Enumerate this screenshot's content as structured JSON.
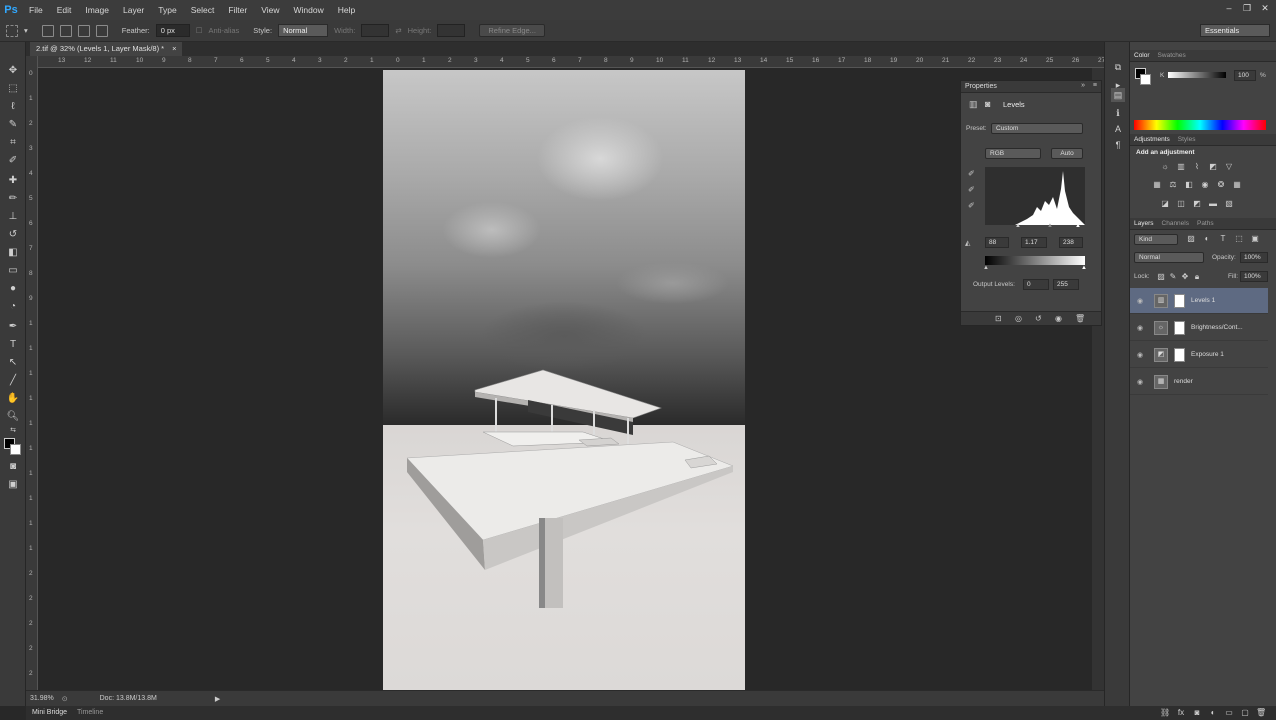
{
  "app": {
    "logo": "Ps"
  },
  "menu": [
    "File",
    "Edit",
    "Image",
    "Layer",
    "Type",
    "Select",
    "Filter",
    "View",
    "Window",
    "Help"
  ],
  "window_controls": [
    "–",
    "❐",
    "✕"
  ],
  "options": {
    "feather_label": "Feather:",
    "feather_value": "0 px",
    "antialias_label": "Anti-alias",
    "style_label": "Style:",
    "style_value": "Normal",
    "width_label": "Width:",
    "height_label": "Height:",
    "refine_edge": "Refine Edge...",
    "workspace": "Essentials"
  },
  "document": {
    "tab_title": "2.tif @ 32% (Levels 1, Layer Mask/8) *",
    "tab_close": "×",
    "zoom": "31.98%",
    "doc_size": "Doc: 13.8M/13.8M"
  },
  "ruler_top": [
    "13",
    "12",
    "11",
    "10",
    "9",
    "8",
    "7",
    "6",
    "5",
    "4",
    "3",
    "2",
    "1",
    "0",
    "1",
    "2",
    "3",
    "4",
    "5",
    "6",
    "7",
    "8",
    "9",
    "10",
    "11",
    "12",
    "13",
    "14",
    "15",
    "16",
    "17",
    "18",
    "19",
    "20",
    "21",
    "22",
    "23",
    "24",
    "25",
    "26",
    "27"
  ],
  "ruler_left": [
    "0",
    "1",
    "2",
    "3",
    "4",
    "5",
    "6",
    "7",
    "8",
    "9",
    "1",
    "1",
    "1",
    "1",
    "1",
    "1",
    "1",
    "1",
    "1",
    "1",
    "2",
    "2",
    "2",
    "2",
    "2"
  ],
  "bottom_tabs": [
    "Mini Bridge",
    "Timeline"
  ],
  "properties": {
    "title": "Properties",
    "header": "Levels",
    "preset_label": "Preset:",
    "preset_value": "Custom",
    "channel": "RGB",
    "auto": "Auto",
    "input_black": "88",
    "input_gamma": "1.17",
    "input_white": "238",
    "output_label": "Output Levels:",
    "output_black": "0",
    "output_white": "255"
  },
  "color_panel": {
    "tabs": [
      "Color",
      "Swatches"
    ],
    "channel_label": "K",
    "value": "100",
    "unit": "%"
  },
  "adjustments": {
    "tabs": [
      "Adjustments",
      "Styles"
    ],
    "heading": "Add an adjustment"
  },
  "layers_panel": {
    "tabs": [
      "Layers",
      "Channels",
      "Paths"
    ],
    "kind": "Kind",
    "blend_mode": "Normal",
    "opacity_label": "Opacity:",
    "opacity_value": "100%",
    "lock_label": "Lock:",
    "fill_label": "Fill:",
    "fill_value": "100%",
    "layers": [
      {
        "name": "Levels 1",
        "selected": true,
        "icon": "levels-icon"
      },
      {
        "name": "Brightness/Cont...",
        "selected": false,
        "icon": "brightness-icon"
      },
      {
        "name": "Exposure 1",
        "selected": false,
        "icon": "exposure-icon"
      },
      {
        "name": "render",
        "selected": false,
        "icon": "image-thumb"
      }
    ]
  },
  "colors": {
    "selected_layer": "#5e6a82",
    "ps_blue": "#31a8ff"
  }
}
